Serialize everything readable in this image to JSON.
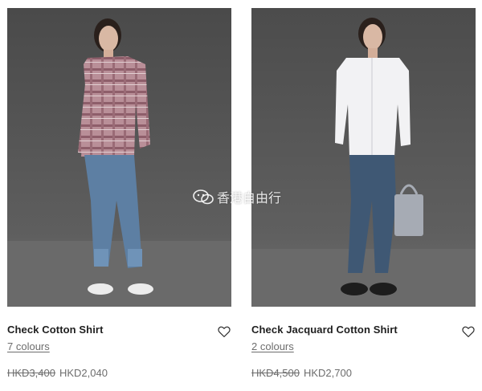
{
  "products": [
    {
      "name": "Check Cotton Shirt",
      "colours_label": "7 colours",
      "price_original": "HKD3,400",
      "price_sale": "HKD2,040",
      "favorite_icon": "heart-outline-icon"
    },
    {
      "name": "Check Jacquard Cotton Shirt",
      "colours_label": "2 colours",
      "price_original": "HKD4,500",
      "price_sale": "HKD2,700",
      "favorite_icon": "heart-outline-icon"
    }
  ],
  "watermark": {
    "text": "香港自由行",
    "icon": "wechat-icon"
  },
  "colors": {
    "photo_background": "#5b5b5b",
    "text_primary": "#1e1e1e",
    "text_secondary": "#6d6d6d"
  }
}
